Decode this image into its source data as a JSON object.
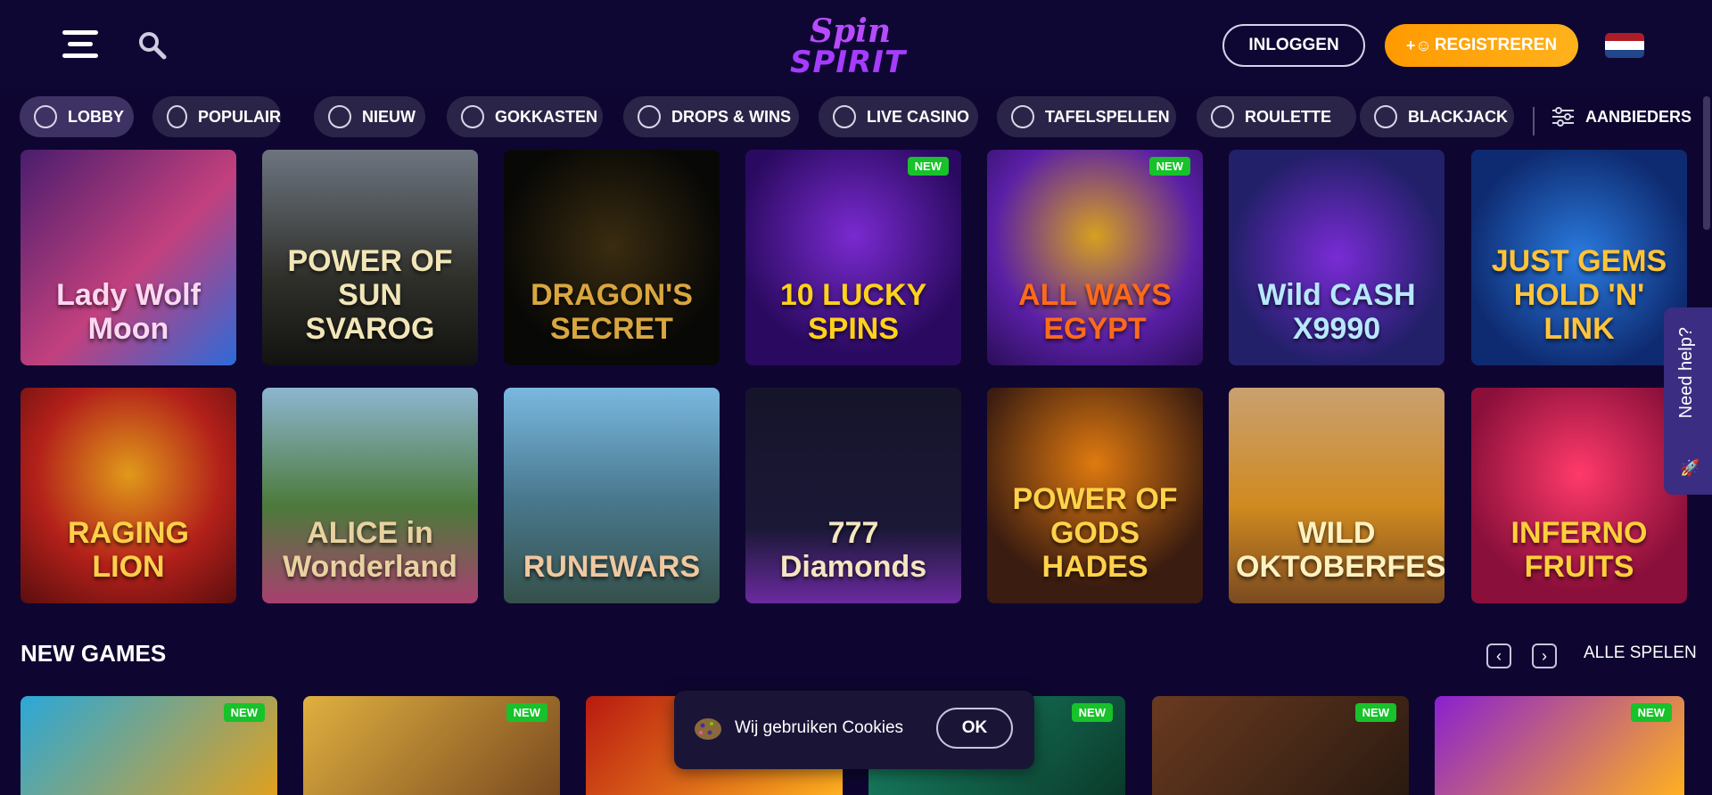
{
  "header": {
    "logo_top": "Spin",
    "logo_bottom": "SPIRIT",
    "login_label": "INLOGGEN",
    "register_label": "REGISTREREN",
    "flag_colors": [
      "#ae1c28",
      "#ffffff",
      "#21468b"
    ]
  },
  "nav": {
    "items": [
      {
        "label": "LOBBY",
        "icon": "lobby-icon",
        "active": true
      },
      {
        "label": "POPULAIR",
        "icon": "sun-icon",
        "active": false
      },
      {
        "label": "NIEUW",
        "icon": "sparkle-icon",
        "active": false
      },
      {
        "label": "GOKKASTEN",
        "icon": "slot-machine-icon",
        "active": false
      },
      {
        "label": "DROPS & WINS",
        "icon": "drop-icon",
        "active": false
      },
      {
        "label": "LIVE CASINO",
        "icon": "live-casino-icon",
        "active": false
      },
      {
        "label": "TAFELSPELLEN",
        "icon": "table-games-icon",
        "active": false
      },
      {
        "label": "ROULETTE",
        "icon": "roulette-icon",
        "active": false
      },
      {
        "label": "BLACKJACK",
        "icon": "blackjack-icon",
        "active": false
      }
    ],
    "providers_label": "AANBIEDERS"
  },
  "games_row1": [
    {
      "title": "Lady Wolf Moon",
      "badge": ""
    },
    {
      "title": "POWER OF SUN SVAROG",
      "badge": ""
    },
    {
      "title": "DRAGON'S SECRET",
      "badge": ""
    },
    {
      "title": "10 LUCKY SPINS",
      "badge": "NEW"
    },
    {
      "title": "ALL WAYS EGYPT",
      "badge": "NEW"
    },
    {
      "title": "Wild CASH X9990",
      "badge": ""
    },
    {
      "title": "JUST GEMS HOLD 'N' LINK",
      "badge": ""
    }
  ],
  "games_row2": [
    {
      "title": "RAGING LION",
      "badge": ""
    },
    {
      "title": "ALICE in Wonderland",
      "badge": ""
    },
    {
      "title": "RUNEWARS",
      "badge": ""
    },
    {
      "title": "777 Diamonds",
      "badge": ""
    },
    {
      "title": "POWER OF GODS HADES",
      "badge": ""
    },
    {
      "title": "WILD OKTOBERFEST",
      "badge": ""
    },
    {
      "title": "INFERNO FRUITS",
      "badge": ""
    }
  ],
  "new_games": {
    "title": "NEW GAMES",
    "all_label": "ALLE SPELEN",
    "prev_icon": "chevron-left-icon",
    "next_icon": "chevron-right-icon",
    "badges": [
      "NEW",
      "NEW",
      "",
      "NEW",
      "NEW",
      "NEW"
    ]
  },
  "help": {
    "label": "Need help?"
  },
  "cookie": {
    "text": "Wij gebruiken Cookies",
    "ok_label": "OK"
  }
}
